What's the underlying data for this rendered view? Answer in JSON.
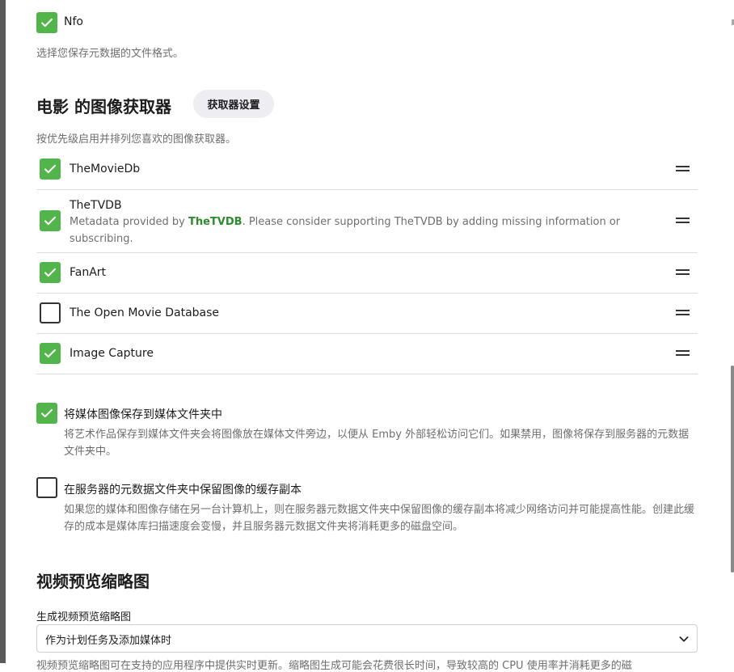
{
  "nfo": {
    "label": "Nfo",
    "checked": true,
    "help": "选择您保存元数据的文件格式。"
  },
  "image_fetchers": {
    "title": "电影 的图像获取器",
    "settings_button": "获取器设置",
    "help": "按优先级启用并排列您喜欢的图像获取器。",
    "items": [
      {
        "name": "TheMovieDb",
        "checked": true
      },
      {
        "name": "TheTVDB",
        "checked": true,
        "desc_before": "Metadata provided by ",
        "desc_link": "TheTVDB",
        "desc_after": ". Please consider supporting TheTVDB by adding missing information or subscribing."
      },
      {
        "name": "FanArt",
        "checked": true
      },
      {
        "name": "The Open Movie Database",
        "checked": false
      },
      {
        "name": "Image Capture",
        "checked": true
      }
    ]
  },
  "save_to_media_folder": {
    "label": "将媒体图像保存到媒体文件夹中",
    "checked": true,
    "help": "将艺术作品保存到媒体文件夹会将图像放在媒体文件旁边，以便从 Emby 外部轻松访问它们。如果禁用，图像将保存到服务器的元数据文件夹中。"
  },
  "cache_copy": {
    "label": "在服务器的元数据文件夹中保留图像的缓存副本",
    "checked": false,
    "help": "如果您的媒体和图像存储在另一台计算机上，则在服务器元数据文件夹中保留图像的缓存副本将减少网络访问并可能提高性能。创建此缓存的成本是媒体库扫描速度会变慢，并且服务器元数据文件夹将消耗更多的磁盘空间。"
  },
  "thumbnails": {
    "title": "视频预览缩略图",
    "field_label": "生成视频预览缩略图",
    "selected": "作为计划任务及添加媒体时",
    "help_partial": "视频预览缩略图可在支持的应用程序中提供实时更新。缩略图生成可能会花费很长时间，导致较高的 CPU 使用率并消耗更多的磁"
  },
  "colors": {
    "accent": "#52b54b",
    "link": "#2e8b2e"
  },
  "icons": {
    "check": "check-icon",
    "drag": "drag-handle-icon",
    "dropdown": "chevron-down-icon"
  }
}
